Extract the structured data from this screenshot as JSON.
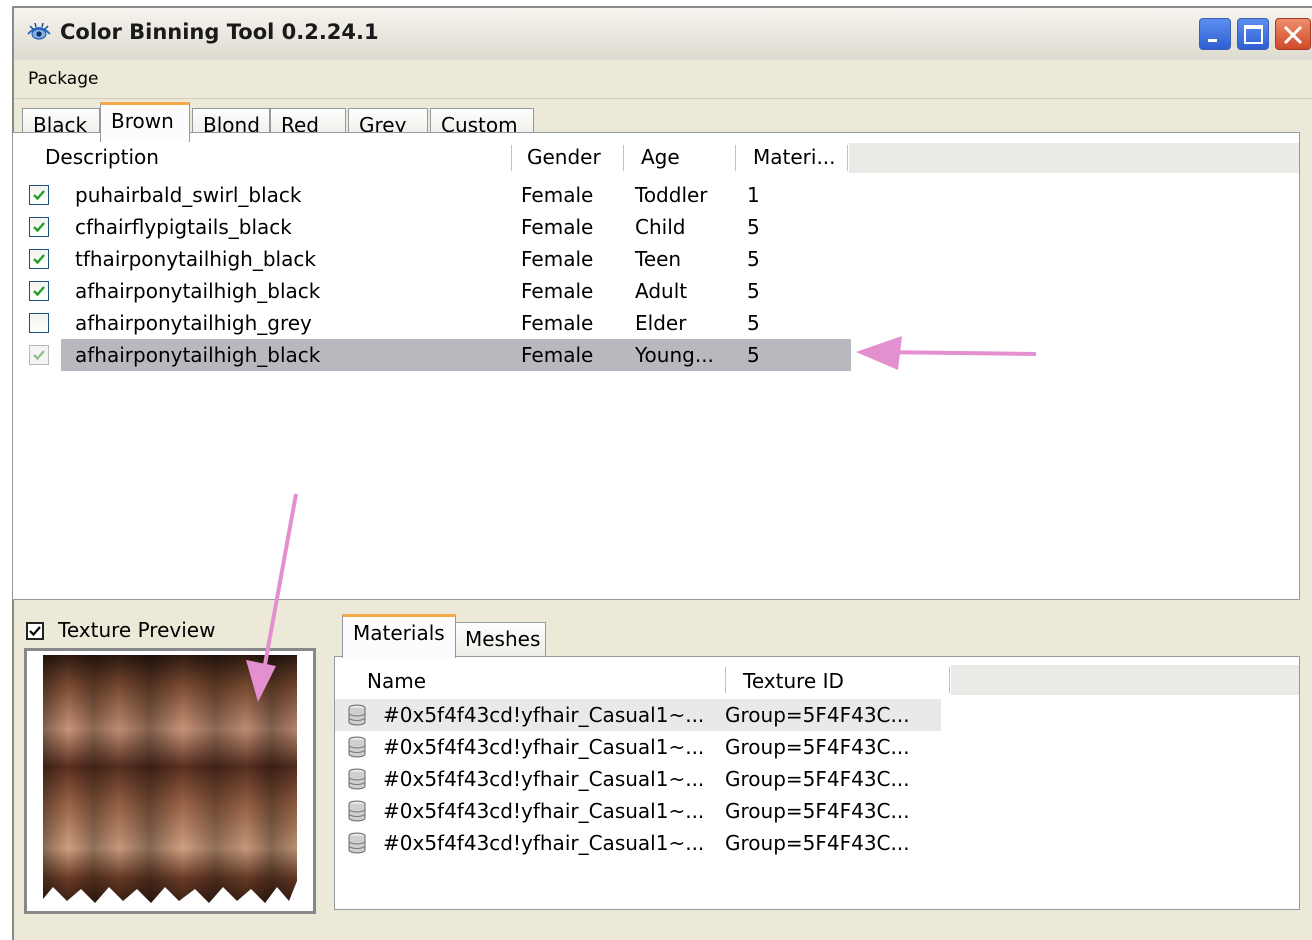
{
  "window": {
    "title": "Color Binning Tool 0.2.24.1"
  },
  "menu": {
    "items": [
      "Package"
    ]
  },
  "top_tabs": [
    {
      "label": "Black",
      "active": false
    },
    {
      "label": "Brown",
      "active": true
    },
    {
      "label": "Blond",
      "active": false
    },
    {
      "label": "Red",
      "active": false
    },
    {
      "label": "Grey",
      "active": false
    },
    {
      "label": "Custom",
      "active": false
    }
  ],
  "list": {
    "columns": [
      "Description",
      "Gender",
      "Age",
      "Materi..."
    ],
    "rows": [
      {
        "checked": true,
        "description": "puhairbald_swirl_black",
        "gender": "Female",
        "age": "Toddler",
        "materials": "1",
        "selected": false
      },
      {
        "checked": true,
        "description": "cfhairflypigtails_black",
        "gender": "Female",
        "age": "Child",
        "materials": "5",
        "selected": false
      },
      {
        "checked": true,
        "description": "tfhairponytailhigh_black",
        "gender": "Female",
        "age": "Teen",
        "materials": "5",
        "selected": false
      },
      {
        "checked": true,
        "description": "afhairponytailhigh_black",
        "gender": "Female",
        "age": "Adult",
        "materials": "5",
        "selected": false
      },
      {
        "checked": false,
        "description": "afhairponytailhigh_grey",
        "gender": "Female",
        "age": "Elder",
        "materials": "5",
        "selected": false
      },
      {
        "checked": true,
        "description": "afhairponytailhigh_black",
        "gender": "Female",
        "age": "Young...",
        "materials": "5",
        "selected": true
      }
    ]
  },
  "preview": {
    "label": "Texture Preview",
    "checked": true
  },
  "bottom_tabs": [
    {
      "label": "Materials",
      "active": true
    },
    {
      "label": "Meshes",
      "active": false
    }
  ],
  "materials": {
    "columns": [
      "Name",
      "Texture ID"
    ],
    "rows": [
      {
        "name": "#0x5f4f43cd!yfhair_Casual1~...",
        "texture_id": "Group=5F4F43C...",
        "selected": true
      },
      {
        "name": "#0x5f4f43cd!yfhair_Casual1~...",
        "texture_id": "Group=5F4F43C...",
        "selected": false
      },
      {
        "name": "#0x5f4f43cd!yfhair_Casual1~...",
        "texture_id": "Group=5F4F43C...",
        "selected": false
      },
      {
        "name": "#0x5f4f43cd!yfhair_Casual1~...",
        "texture_id": "Group=5F4F43C...",
        "selected": false
      },
      {
        "name": "#0x5f4f43cd!yfhair_Casual1~...",
        "texture_id": "Group=5F4F43C...",
        "selected": false
      }
    ]
  },
  "icons": {
    "app": "eye-icon",
    "minimize": "minimize-icon",
    "maximize": "maximize-icon",
    "close": "close-icon",
    "row": "database-icon",
    "check": "check-icon"
  },
  "colors": {
    "accent_tab": "#f7a94a",
    "selection": "#b7b9be",
    "annotation_arrow": "#e38fd0",
    "checkmark": "#21a121"
  }
}
